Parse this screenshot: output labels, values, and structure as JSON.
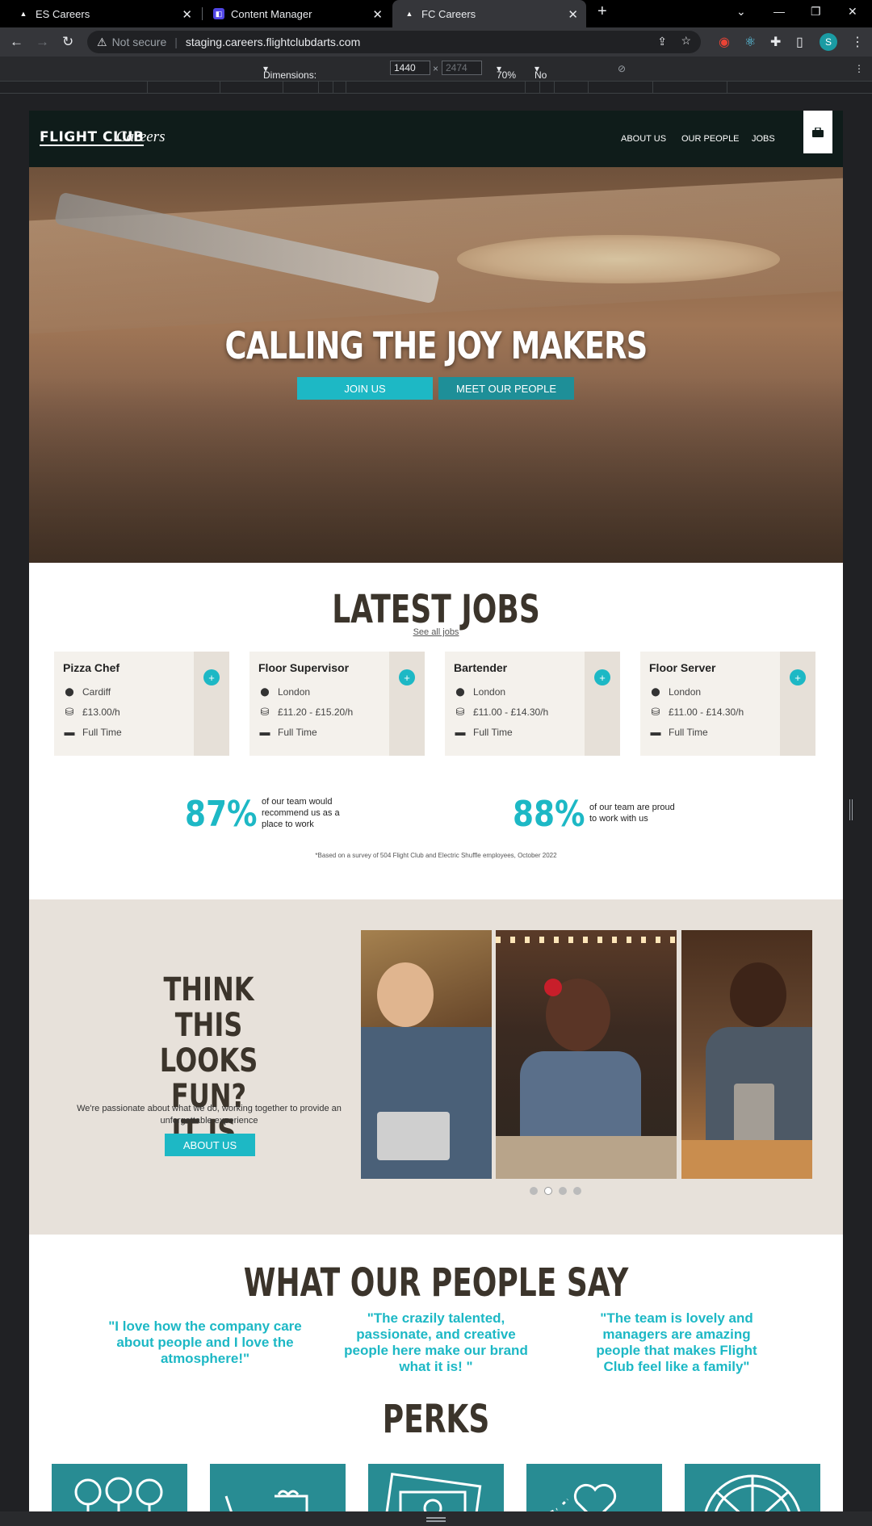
{
  "browser": {
    "tabs": [
      {
        "title": "ES Careers",
        "icon": "triangle-icon"
      },
      {
        "title": "Content Manager",
        "icon": "cms-icon"
      },
      {
        "title": "FC Careers",
        "icon": "triangle-icon",
        "active": true
      }
    ],
    "security": "Not secure",
    "url": "staging.careers.flightclubdarts.com",
    "profile_initial": "S"
  },
  "devtools": {
    "dimensions_label": "Dimensions: Responsive",
    "width": "1440",
    "height_placeholder": "2474",
    "times": "×",
    "zoom": "70%",
    "throttling": "No throttling"
  },
  "site": {
    "logo": "FLIGHT CLUB",
    "logo_sub": "Careers",
    "menu": [
      "ABOUT US",
      "OUR PEOPLE",
      "JOBS"
    ],
    "hero": {
      "title": "CALLING THE JOY MAKERS",
      "join_button": "JOIN US",
      "people_button": "MEET OUR PEOPLE"
    },
    "jobs": {
      "title": "LATEST JOBS",
      "see_all": "See all jobs",
      "cards": [
        {
          "title": "Pizza Chef",
          "location": "Cardiff",
          "pay": "£13.00/h",
          "type": "Full Time"
        },
        {
          "title": "Floor Supervisor",
          "location": "London",
          "pay": "£11.20 - £15.20/h",
          "type": "Full Time"
        },
        {
          "title": "Bartender",
          "location": "London",
          "pay": "£11.00 - £14.30/h",
          "type": "Full Time"
        },
        {
          "title": "Floor Server",
          "location": "London",
          "pay": "£11.00 - £14.30/h",
          "type": "Full Time"
        }
      ]
    },
    "stats": [
      {
        "value": "87%",
        "text": "of our team would recommend us as a place to work"
      },
      {
        "value": "88%",
        "text": "of our team are proud to work with us"
      }
    ],
    "footnote": "*Based on a survey of 504 Flight Club and Electric Shuffle employees, October 2022",
    "fun": {
      "title_line1": "THINK THIS",
      "title_line2": "LOOKS FUN?",
      "title_line3": "IT IS.",
      "text": "We're passionate about what we do, working together to provide an unforgettable experience",
      "button": "ABOUT US",
      "slide_count": 4,
      "active_slide": 2
    },
    "people_say": {
      "title": "WHAT OUR PEOPLE SAY",
      "quotes": [
        "\"I love how the company care about people and I love the atmosphere!\"",
        "\"The crazily talented, passionate, and creative people here make our brand what it is! \"",
        "\"The team is lovely and managers are amazing people that makes Flight Club feel like a family\""
      ]
    },
    "perks": {
      "title": "PERKS",
      "icons": [
        "lightbulbs-icon",
        "drinks-icon",
        "money-icon",
        "heart-icon",
        "pizza-icon"
      ]
    }
  },
  "colors": {
    "teal": "#1db8c5",
    "dark_teal": "#288c93",
    "header": "#0f1c1a",
    "headline": "#3b342b",
    "beige": "#e7e1da"
  }
}
